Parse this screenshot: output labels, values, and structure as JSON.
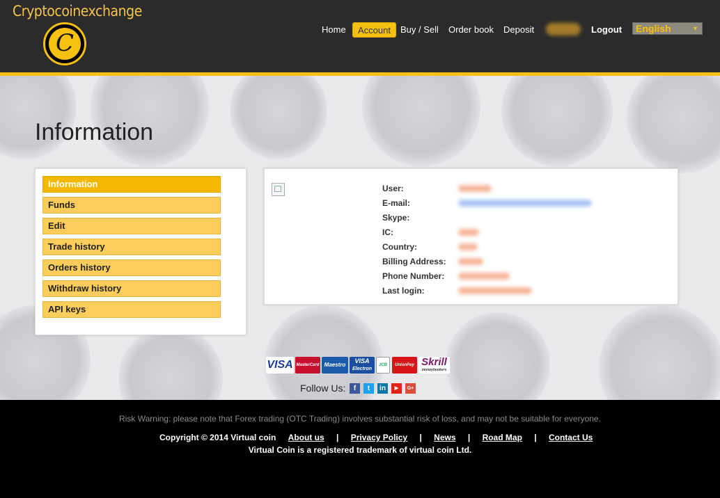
{
  "header": {
    "logo_text": "Cryptocoinexchange",
    "logo_mark": "C",
    "nav": [
      {
        "label": "Home"
      },
      {
        "label": "Account"
      },
      {
        "label": "Buy / Sell"
      },
      {
        "label": "Order book"
      },
      {
        "label": "Deposit"
      },
      {
        "label": "Logout"
      }
    ],
    "language": "English",
    "language_arrow": "▼"
  },
  "page": {
    "title": "Information"
  },
  "sidebar": {
    "items": [
      {
        "label": "Information"
      },
      {
        "label": "Funds"
      },
      {
        "label": "Edit"
      },
      {
        "label": "Trade history"
      },
      {
        "label": "Orders history"
      },
      {
        "label": "Withdraw history"
      },
      {
        "label": "API keys"
      }
    ]
  },
  "info": {
    "fields": [
      {
        "label": "User:"
      },
      {
        "label": "E-mail:"
      },
      {
        "label": "Skype:"
      },
      {
        "label": "IC:"
      },
      {
        "label": "Country:"
      },
      {
        "label": "Billing Address:"
      },
      {
        "label": "Phone Number:"
      },
      {
        "label": "Last login:"
      }
    ]
  },
  "payments": {
    "visa": "VISA",
    "mastercard": "MasterCard",
    "maestro": "Maestro",
    "visa_electron": "VISA",
    "visa_electron_sub": "Electron",
    "jcb": "JCB",
    "unionpay": "UnionPay",
    "skrill": "Skrill",
    "skrill_sub": "moneybookers"
  },
  "social": {
    "follow_label": "Follow Us:",
    "icons": [
      "f",
      "t",
      "in",
      "▶",
      "G+"
    ]
  },
  "footer": {
    "risk_warning": "Risk Warning: please note that Forex trading (OTC Trading) involves substantial risk of loss, and may not be suitable for everyone.",
    "copyright": "Copyright © 2014 Virtual coin",
    "links": [
      "About us",
      "Privacy Policy",
      "News",
      "Road Map",
      "Contact Us"
    ],
    "separator": "|",
    "trademark": "Virtual Coin is a registered trademark of virtual coin Ltd."
  },
  "colors": {
    "accent": "#f5c00f",
    "header_bg": "#2b2b2b",
    "sidebar_item": "#fccd5a",
    "footer_bg": "#000000"
  }
}
